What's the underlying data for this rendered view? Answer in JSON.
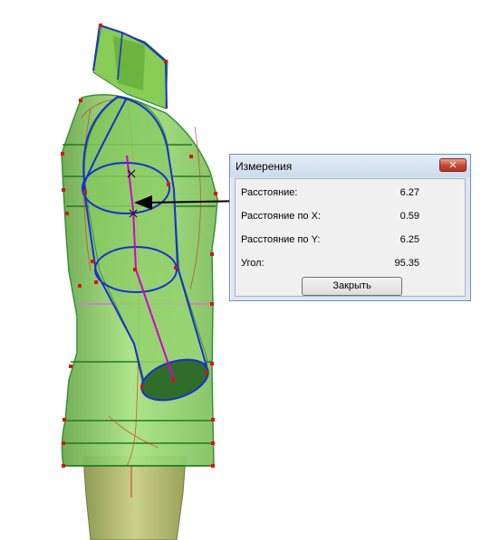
{
  "dialog": {
    "title": "Измерения",
    "close_glyph": "✕",
    "rows": [
      {
        "label": "Расстояние:",
        "value": "6.27"
      },
      {
        "label": "Расстояние по X:",
        "value": "0.59"
      },
      {
        "label": "Расстояние по Y:",
        "value": "6.25"
      },
      {
        "label": "Угол:",
        "value": "95.35"
      }
    ],
    "close_button_label": "Закрыть"
  },
  "colors": {
    "body_green": "#8fd46a",
    "outline_green": "#2a8a2a",
    "measure_blue": "#1a2fd0",
    "control_point_red": "#e01010",
    "axis_magenta": "#d000d0",
    "pointer_arrow": "#000000"
  },
  "icons": {
    "close": "close-icon"
  }
}
